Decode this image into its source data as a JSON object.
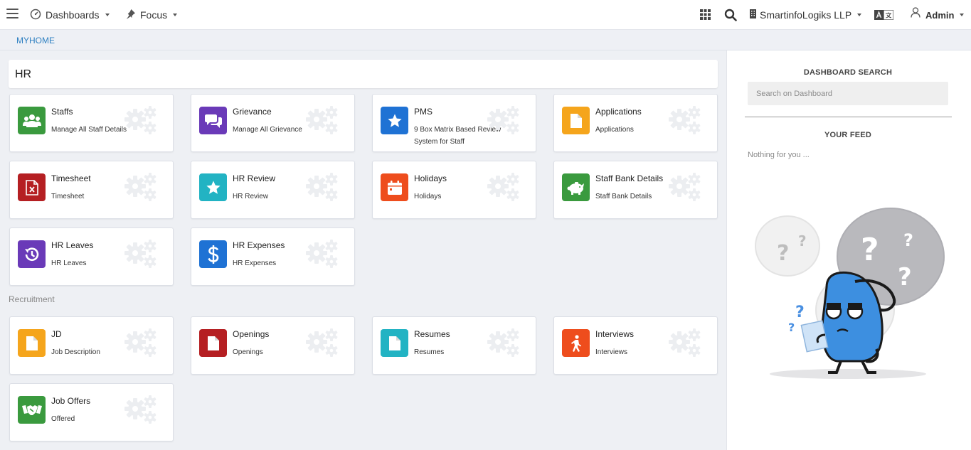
{
  "topbar": {
    "dashboards_label": "Dashboards",
    "focus_label": "Focus",
    "company_label": "SmartinfoLogiks LLP",
    "user_label": "Admin"
  },
  "breadcrumb": "MYHOME",
  "section_title": "HR",
  "hr_cards": [
    {
      "title": "Staffs",
      "subtitle": "Manage All Staff Details",
      "icon": "users-icon",
      "color": "#3a9a3e"
    },
    {
      "title": "Grievance",
      "subtitle": "Manage All Grievance",
      "icon": "chat-icon",
      "color": "#6a3ab8"
    },
    {
      "title": "PMS",
      "subtitle": "9 Box Matrix Based Review System for Staff",
      "icon": "star-icon",
      "color": "#1f72d4"
    },
    {
      "title": "Applications",
      "subtitle": "Applications",
      "icon": "document-icon",
      "color": "#f5a51c"
    },
    {
      "title": "Timesheet",
      "subtitle": "Timesheet",
      "icon": "excel-file-icon",
      "color": "#b51f22"
    },
    {
      "title": "HR Review",
      "subtitle": "HR Review",
      "icon": "star-icon",
      "color": "#22b3c3"
    },
    {
      "title": "Holidays",
      "subtitle": "Holidays",
      "icon": "calendar-icon",
      "color": "#ee4d1d"
    },
    {
      "title": "Staff Bank Details",
      "subtitle": "Staff Bank Details",
      "icon": "piggy-bank-icon",
      "color": "#3a9a3e"
    },
    {
      "title": "HR Leaves",
      "subtitle": "HR Leaves",
      "icon": "history-icon",
      "color": "#6a3ab8"
    },
    {
      "title": "HR Expenses",
      "subtitle": "HR Expenses",
      "icon": "dollar-icon",
      "color": "#1f72d4"
    }
  ],
  "recruitment_label": "Recruitment",
  "recruitment_cards": [
    {
      "title": "JD",
      "subtitle": "Job Description",
      "icon": "document-icon",
      "color": "#f5a51c"
    },
    {
      "title": "Openings",
      "subtitle": "Openings",
      "icon": "document-icon",
      "color": "#b51f22"
    },
    {
      "title": "Resumes",
      "subtitle": "Resumes",
      "icon": "document-icon",
      "color": "#22b3c3"
    },
    {
      "title": "Interviews",
      "subtitle": "Interviews",
      "icon": "walking-icon",
      "color": "#ee4d1d"
    },
    {
      "title": "Job Offers",
      "subtitle": "Offered",
      "icon": "handshake-icon",
      "color": "#3a9a3e"
    }
  ],
  "sidebar": {
    "search_heading": "DASHBOARD SEARCH",
    "search_placeholder": "Search on Dashboard",
    "feed_heading": "YOUR FEED",
    "feed_empty": "Nothing for you ..."
  }
}
